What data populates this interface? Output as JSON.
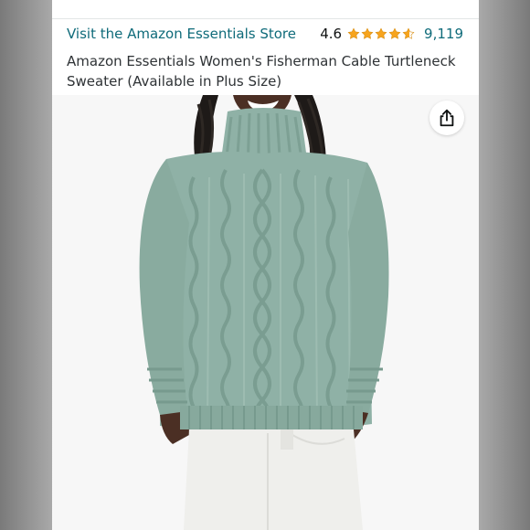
{
  "store": {
    "link_text": "Visit the Amazon Essentials Store"
  },
  "rating": {
    "value": "4.6",
    "stars_filled": 4.6,
    "count": "9,119",
    "star_color": "#f7a41d"
  },
  "product": {
    "title": "Amazon Essentials Women's Fisherman Cable Turtleneck Sweater (Available in Plus Size)",
    "image_subject": "woman-in-sage-green-cable-knit-turtleneck-and-white-jeans"
  },
  "colors": {
    "link": "#0f6b7a",
    "sweater": "#8fb1a6",
    "background": "#f7f7f7"
  },
  "icons": {
    "share": "share-icon",
    "star": "star-icon"
  }
}
